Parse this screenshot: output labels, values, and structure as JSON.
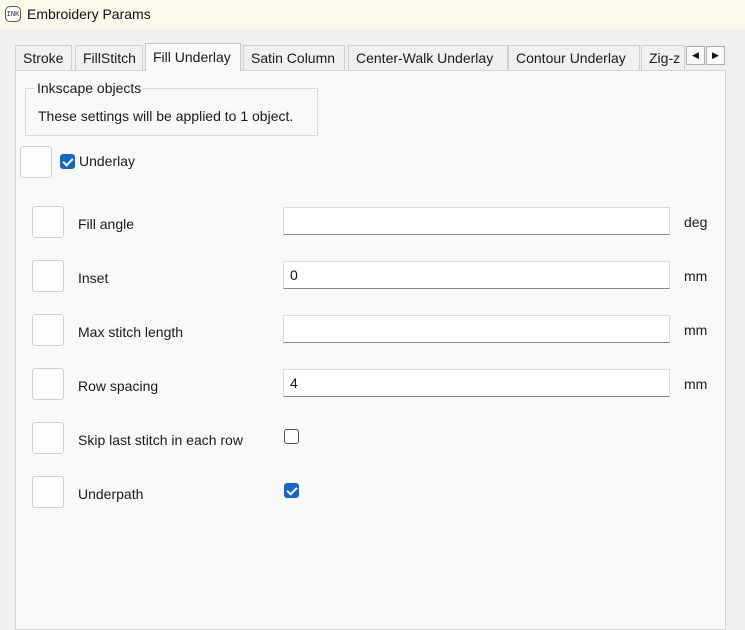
{
  "window": {
    "title": "Embroidery Params",
    "app_icon_text": "INK"
  },
  "tabs": [
    {
      "label": "Stroke",
      "active": false
    },
    {
      "label": "FillStitch",
      "active": false
    },
    {
      "label": "Fill Underlay",
      "active": true
    },
    {
      "label": "Satin Column",
      "active": false
    },
    {
      "label": "Center-Walk Underlay",
      "active": false
    },
    {
      "label": "Contour Underlay",
      "active": false
    },
    {
      "label": "Zig-z",
      "active": false
    }
  ],
  "tab_scroll": {
    "left": "◀",
    "right": "▶"
  },
  "objects_group": {
    "title": "Inkscape objects",
    "text": "These settings will be applied to 1 object."
  },
  "underlay": {
    "label": "Underlay",
    "checked": true
  },
  "params": [
    {
      "label": "Fill angle",
      "type": "text",
      "value": "",
      "unit": "deg"
    },
    {
      "label": "Inset",
      "type": "text",
      "value": "0",
      "unit": "mm"
    },
    {
      "label": "Max stitch length",
      "type": "text",
      "value": "",
      "unit": "mm"
    },
    {
      "label": "Row spacing",
      "type": "text",
      "value": "4",
      "unit": "mm"
    },
    {
      "label": "Skip last stitch in each row",
      "type": "checkbox",
      "checked": false
    },
    {
      "label": "Underpath",
      "type": "checkbox",
      "checked": true
    }
  ],
  "colors": {
    "accent": "#1666c7",
    "titlebar": "#fcf8ec",
    "panel": "#f9f9f9"
  }
}
